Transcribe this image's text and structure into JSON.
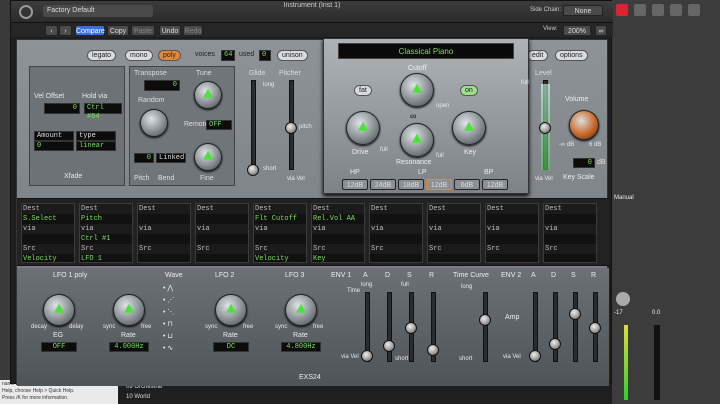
{
  "window": {
    "title": "Instrument (Inst 1)"
  },
  "toolbar": {
    "preset": "Factory Default",
    "compare": "Compare",
    "copy": "Copy",
    "paste": "Paste",
    "undo": "Undo",
    "redo": "Redo",
    "side_chain_label": "Side Chain:",
    "side_chain_value": "None",
    "view_label": "View:",
    "view_value": "200%"
  },
  "top": {
    "legato": "legato",
    "mono": "mono",
    "poly": "poly",
    "voices_label": "voices",
    "voices_value": "64",
    "used_label": "used",
    "used_value": "0",
    "unison": "unison",
    "instrument": "Classical Piano",
    "edit": "edit",
    "options": "options"
  },
  "left": {
    "vel_offset": "Vel Offset",
    "hold_via": "Hold via",
    "vel_value": "0",
    "hold_value": "Ctrl #64",
    "amount": "Amount",
    "type": "type",
    "amount_value": "0",
    "type_value": "linear",
    "xfade": "Xfade"
  },
  "pitch": {
    "transpose": "Transpose",
    "transpose_value": "0",
    "tune": "Tune",
    "random": "Random",
    "remote": "Remote",
    "remote_value": "OFF",
    "pitch_bend": "Pitch",
    "bend": "Bend",
    "bend_value": "0",
    "linked": "Linked",
    "fine": "Fine",
    "glide": "Glide",
    "pitcher": "Pitcher",
    "long": "long",
    "short": "short",
    "via_vel": "via Vel",
    "pitch_high": "pitch"
  },
  "filter": {
    "cutoff": "Cutoff",
    "fat": "fat",
    "on": "on",
    "drive": "Drive",
    "resonance": "Resonance",
    "key": "Key",
    "open": "open",
    "full": "full",
    "hp": "HP",
    "lp": "LP",
    "bp": "BP",
    "slopes": [
      "12dB",
      "24dB",
      "18dB",
      "12dB",
      "6dB",
      "12dB"
    ]
  },
  "level": {
    "level": "Level",
    "volume": "Volume",
    "vol_scale": "-∞ dB",
    "vol_scale2": "6 dB",
    "vol_value": "0",
    "vol_unit": "dB",
    "key_scale": "Key Scale",
    "full": "full",
    "via_vel": "via Vel"
  },
  "mod_slots": [
    {
      "dest": "Dest",
      "dval": "S.Select",
      "via": "via",
      "src": "Src",
      "sval": "Velocity"
    },
    {
      "dest": "Dest",
      "dval": "Pitch",
      "via": "via",
      "vval": "Ctrl #1",
      "src": "Src",
      "sval": "LFO 1"
    },
    {
      "dest": "Dest",
      "dval": "",
      "via": "via",
      "src": "Src",
      "sval": ""
    },
    {
      "dest": "Dest",
      "dval": "",
      "via": "via",
      "src": "Src",
      "sval": ""
    },
    {
      "dest": "Dest",
      "dval": "Flt Cutoff",
      "via": "via",
      "src": "Src",
      "sval": "Velocity"
    },
    {
      "dest": "Dest",
      "dval": "Rel.Vol AA",
      "via": "via",
      "src": "Src",
      "sval": "Key"
    },
    {
      "dest": "Dest",
      "dval": "",
      "via": "via",
      "src": "Src",
      "sval": ""
    },
    {
      "dest": "Dest",
      "dval": "",
      "via": "via",
      "src": "Src",
      "sval": ""
    },
    {
      "dest": "Dest",
      "dval": "",
      "via": "via",
      "src": "Src",
      "sval": ""
    },
    {
      "dest": "Dest",
      "dval": "",
      "via": "via",
      "src": "Src",
      "sval": ""
    }
  ],
  "lfo": {
    "lfo1": "LFO 1 poly",
    "wave": "Wave",
    "lfo2": "LFO 2",
    "lfo3": "LFO 3",
    "eg": "EG",
    "eg_value": "OFF",
    "rate": "Rate",
    "rate1_value": "4.000Hz",
    "rate2_value": "DC",
    "rate3_value": "4.800Hz",
    "decay": "decay",
    "delay": "delay",
    "sync": "sync",
    "free": "free"
  },
  "env": {
    "env1": "ENV 1",
    "env2": "ENV 2",
    "a": "A",
    "d": "D",
    "s": "S",
    "r": "R",
    "time": "Time",
    "time_curve": "Time Curve",
    "amp": "Amp",
    "long": "long",
    "short": "short",
    "full": "full",
    "via_vel": "via Vel"
  },
  "footer": {
    "name": "EXS24"
  },
  "host": {
    "help1": "name and function. To hide or show Quick",
    "help2": "Help, choose Help > Quick Help.",
    "help3": "Press /K for more information.",
    "lib1": "09 Orchestral",
    "lib2": "10 World",
    "manual": "Manual",
    "val1": "-17",
    "val2": "0.0"
  }
}
